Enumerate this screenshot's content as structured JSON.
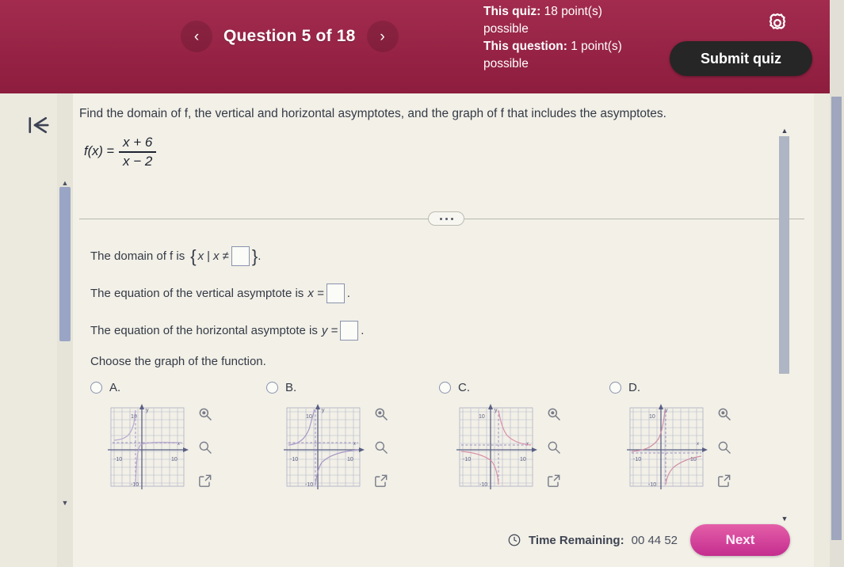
{
  "header": {
    "question_nav": {
      "prev_icon": "chevron-left-icon",
      "next_icon": "chevron-right-icon",
      "title": "Question 5 of 18"
    },
    "quiz_points_label": "This quiz:",
    "quiz_points_value": "18 point(s) possible",
    "question_points_label": "This question:",
    "question_points_value": "1 point(s) possible",
    "gear_icon": "gear-icon",
    "submit_label": "Submit quiz",
    "bg_color": "#9d2045",
    "submit_bg_color": "#262626"
  },
  "sidebar": {
    "back_to_start_icon": "skip-to-start-icon"
  },
  "question": {
    "prompt": "Find the domain of f, the vertical and horizontal asymptotes, and the graph of f that includes the asymptotes.",
    "function_lhs": "f(x) =",
    "function_numerator": "x + 6",
    "function_denominator": "x − 2",
    "more_options_icon": "ellipsis-icon"
  },
  "answers": {
    "domain_prefix": "The domain of f is",
    "domain_set_open": "{",
    "domain_set_body_1": "x",
    "domain_set_pipe": "|",
    "domain_set_body_2": "x ≠",
    "domain_set_close": "}",
    "domain_period": ".",
    "vertical_prefix": "The equation of the vertical asymptote is",
    "vertical_var": "x =",
    "vertical_period": ".",
    "horizontal_prefix": "The equation of the horizontal asymptote is",
    "horizontal_var": "y =",
    "horizontal_period": ".",
    "choose_graph": "Choose the graph of the function.",
    "input_values": {
      "domain": "",
      "vertical": "",
      "horizontal": ""
    }
  },
  "choices": [
    {
      "letter": "A.",
      "selected": false,
      "tools": [
        "zoom-in-icon",
        "zoom-out-icon",
        "expand-icon"
      ]
    },
    {
      "letter": "B.",
      "selected": false,
      "tools": [
        "zoom-in-icon",
        "zoom-out-icon",
        "expand-icon"
      ]
    },
    {
      "letter": "C.",
      "selected": false,
      "tools": [
        "zoom-in-icon",
        "zoom-out-icon",
        "expand-icon"
      ]
    },
    {
      "letter": "D.",
      "selected": false,
      "tools": [
        "zoom-in-icon",
        "zoom-out-icon",
        "expand-icon"
      ]
    }
  ],
  "graph_axis_labels": {
    "x_label": "x",
    "y_label": "y",
    "top_tick": "10",
    "bottom_tick": "-10",
    "left_tick": "-10",
    "right_tick": "10"
  },
  "footer": {
    "clock_icon": "clock-icon",
    "time_label": "Time Remaining:",
    "time_value": "00 44 52",
    "next_label": "Next",
    "next_bg_color": "#c42d8f"
  },
  "scrollbars": {
    "outer_up_icon": "caret-up-icon",
    "outer_down_icon": "caret-down-icon",
    "inner_up_icon": "caret-up-icon",
    "inner_down_icon": "caret-down-icon"
  }
}
